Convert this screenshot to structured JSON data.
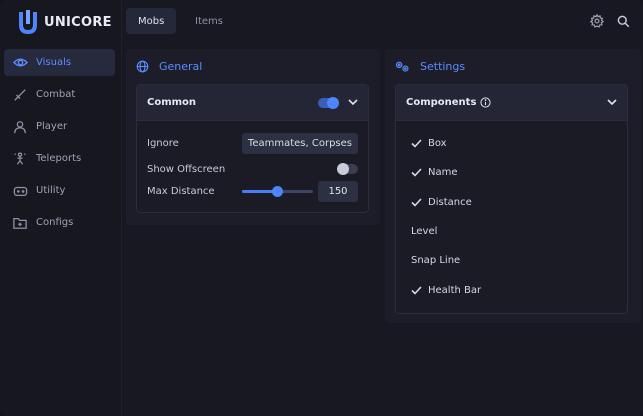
{
  "app": {
    "name": "UNICORE"
  },
  "sidebar": {
    "items": [
      {
        "label": "Visuals",
        "icon": "eye-icon",
        "active": true
      },
      {
        "label": "Combat",
        "icon": "sword-icon",
        "active": false
      },
      {
        "label": "Player",
        "icon": "user-icon",
        "active": false
      },
      {
        "label": "Teleports",
        "icon": "teleport-icon",
        "active": false
      },
      {
        "label": "Utility",
        "icon": "gamepad-icon",
        "active": false
      },
      {
        "label": "Configs",
        "icon": "folder-icon",
        "active": false
      }
    ]
  },
  "topbar": {
    "tabs": [
      {
        "label": "Mobs",
        "active": true
      },
      {
        "label": "Items",
        "active": false
      }
    ],
    "icons": [
      "gear-icon",
      "search-icon"
    ]
  },
  "general": {
    "title": "General",
    "common": {
      "title": "Common",
      "enabled": true,
      "ignore_label": "Ignore",
      "ignore_value": "Teammates, Corpses",
      "show_offscreen_label": "Show Offscreen",
      "show_offscreen_enabled": false,
      "max_distance_label": "Max Distance",
      "max_distance_value": "150",
      "max_distance_fraction": 0.5
    }
  },
  "settings": {
    "title": "Settings",
    "components": {
      "title": "Components",
      "items": [
        {
          "label": "Box",
          "checked": true
        },
        {
          "label": "Name",
          "checked": true
        },
        {
          "label": "Distance",
          "checked": true
        },
        {
          "label": "Level",
          "checked": false
        },
        {
          "label": "Snap Line",
          "checked": false
        },
        {
          "label": "Health Bar",
          "checked": true
        }
      ]
    }
  },
  "colors": {
    "accent": "#5b8cff",
    "background": "#181822",
    "panel": "#1c1d28",
    "toggle_on": "#4f84ff",
    "toggle_off": "#3a3d4e"
  }
}
